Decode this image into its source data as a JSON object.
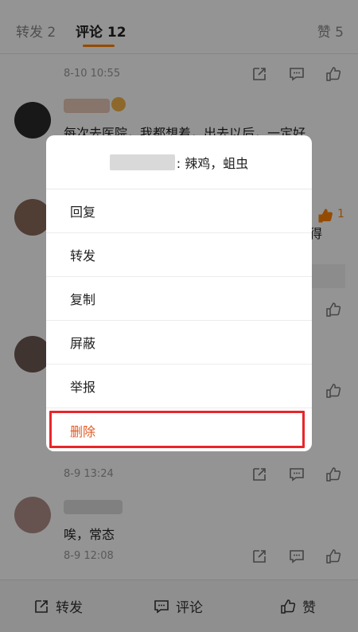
{
  "tabs": {
    "repost": "转发 2",
    "comments": "评论 12",
    "likes": "赞 5"
  },
  "comments": [
    {
      "text": "",
      "time": "8-10 10:55",
      "like_count": ""
    },
    {
      "text": "每次去医院，我都想着，出去以后，一定好",
      "time": "",
      "like_count": "1"
    },
    {
      "text": "得",
      "time": "",
      "like_count": ""
    },
    {
      "text": "",
      "time": "8-9 13:24",
      "like_count": ""
    },
    {
      "text": "唉，常态",
      "time": "8-9 12:08",
      "like_count": ""
    }
  ],
  "dialog": {
    "header_suffix": ": 辣鸡，蛆虫",
    "items": [
      "回复",
      "转发",
      "复制",
      "屏蔽",
      "举报",
      "删除"
    ]
  },
  "bottom_bar": {
    "repost": "转发",
    "comment": "评论",
    "like": "赞"
  },
  "colors": {
    "accent": "#ff8200",
    "delete": "#e35a24",
    "highlight": "#e8262a"
  }
}
